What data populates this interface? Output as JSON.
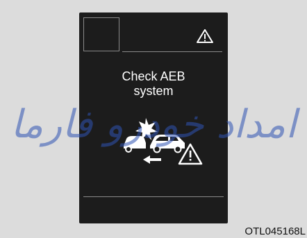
{
  "display": {
    "message_line1": "Check AEB",
    "message_line2": "system",
    "top_icon": "warning-triangle-icon",
    "graphic_icon": "aeb-collision-warning-icon"
  },
  "watermark": {
    "text": "امداد خودرو فارما"
  },
  "figure_code": "OTL045168L",
  "colors": {
    "cluster_bg": "#1c1c1c",
    "page_bg": "#dcdcdc",
    "watermark": "#2f53b4"
  }
}
